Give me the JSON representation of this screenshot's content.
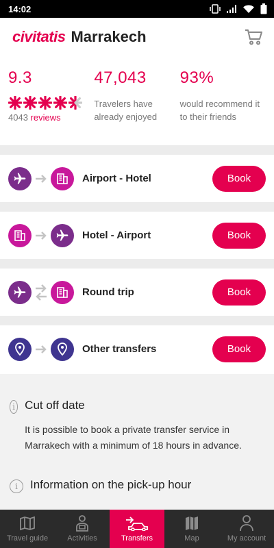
{
  "status": {
    "time": "14:02"
  },
  "header": {
    "brand": "civitatis",
    "city": "Marrakech"
  },
  "stats": {
    "rating": "9.3",
    "stars": 5,
    "review_count": "4043",
    "reviews_label": "reviews",
    "travelers": "47,043",
    "travelers_text": "Travelers have already enjoyed",
    "recommend": "93%",
    "recommend_text": "would recommend it to their friends"
  },
  "transfers": [
    {
      "label": "Airport - Hotel",
      "book": "Book",
      "from_icon": "airplane-icon",
      "to_icon": "building-icon"
    },
    {
      "label": "Hotel - Airport",
      "book": "Book",
      "from_icon": "building-icon",
      "to_icon": "airplane-icon"
    },
    {
      "label": "Round trip",
      "book": "Book",
      "from_icon": "airplane-icon",
      "to_icon": "building-icon"
    },
    {
      "label": "Other transfers",
      "book": "Book",
      "from_icon": "location-pin-icon",
      "to_icon": "location-pin-icon"
    }
  ],
  "info": [
    {
      "title": "Cut off date",
      "body": "It is possible to book a private transfer service in Marrakech with a minimum of 18 hours in advance."
    },
    {
      "title": "Information on the pick-up hour",
      "body": ""
    }
  ],
  "nav": [
    {
      "label": "Travel guide",
      "icon": "map-book-icon",
      "active": false
    },
    {
      "label": "Activities",
      "icon": "person-ticket-icon",
      "active": false
    },
    {
      "label": "Transfers",
      "icon": "transfer-car-icon",
      "active": true
    },
    {
      "label": "Map",
      "icon": "map-icon",
      "active": false
    },
    {
      "label": "My account",
      "icon": "user-icon",
      "active": false
    }
  ],
  "colors": {
    "accent": "#e4004f",
    "purple": "#7b2d8b",
    "magenta": "#c8189b",
    "indigo": "#3f3590",
    "navbar": "#2b2b2b"
  }
}
